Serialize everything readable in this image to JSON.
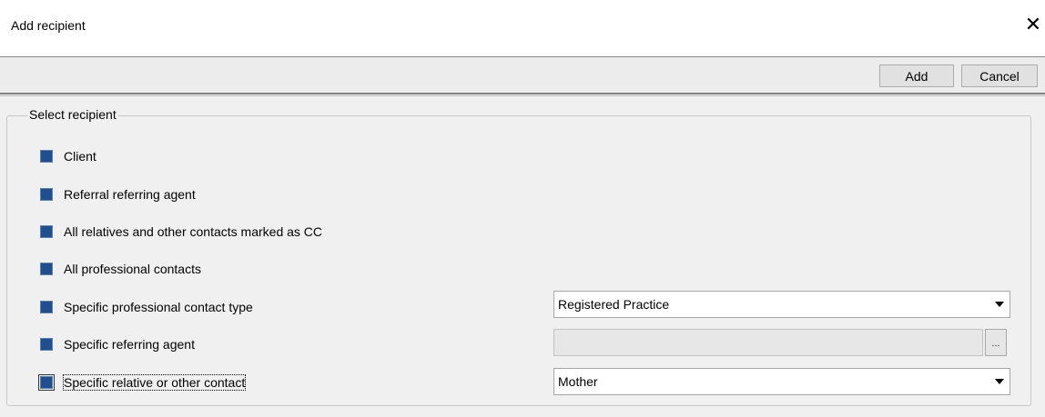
{
  "window": {
    "title": "Add recipient",
    "close_icon": "close-icon"
  },
  "toolbar": {
    "add_label": "Add",
    "cancel_label": "Cancel"
  },
  "group": {
    "legend": "Select recipient",
    "options": [
      {
        "label": "Client",
        "checked": true
      },
      {
        "label": "Referral referring agent",
        "checked": true
      },
      {
        "label": "All relatives and other contacts marked as CC",
        "checked": true
      },
      {
        "label": "All professional contacts",
        "checked": true
      },
      {
        "label": "Specific professional contact type",
        "checked": true
      },
      {
        "label": "Specific referring agent",
        "checked": true
      },
      {
        "label": "Specific relative or other contact",
        "checked": true
      }
    ]
  },
  "professional_contact_type": {
    "value": "Registered Practice",
    "icon": "chevron-down-icon"
  },
  "referring_agent": {
    "value": "",
    "browse_label": "..."
  },
  "relative_contact": {
    "value": "Mother",
    "icon": "chevron-down-icon"
  },
  "colors": {
    "checkbox_fill": "#1f4f8f",
    "background": "#f0f0f0"
  }
}
